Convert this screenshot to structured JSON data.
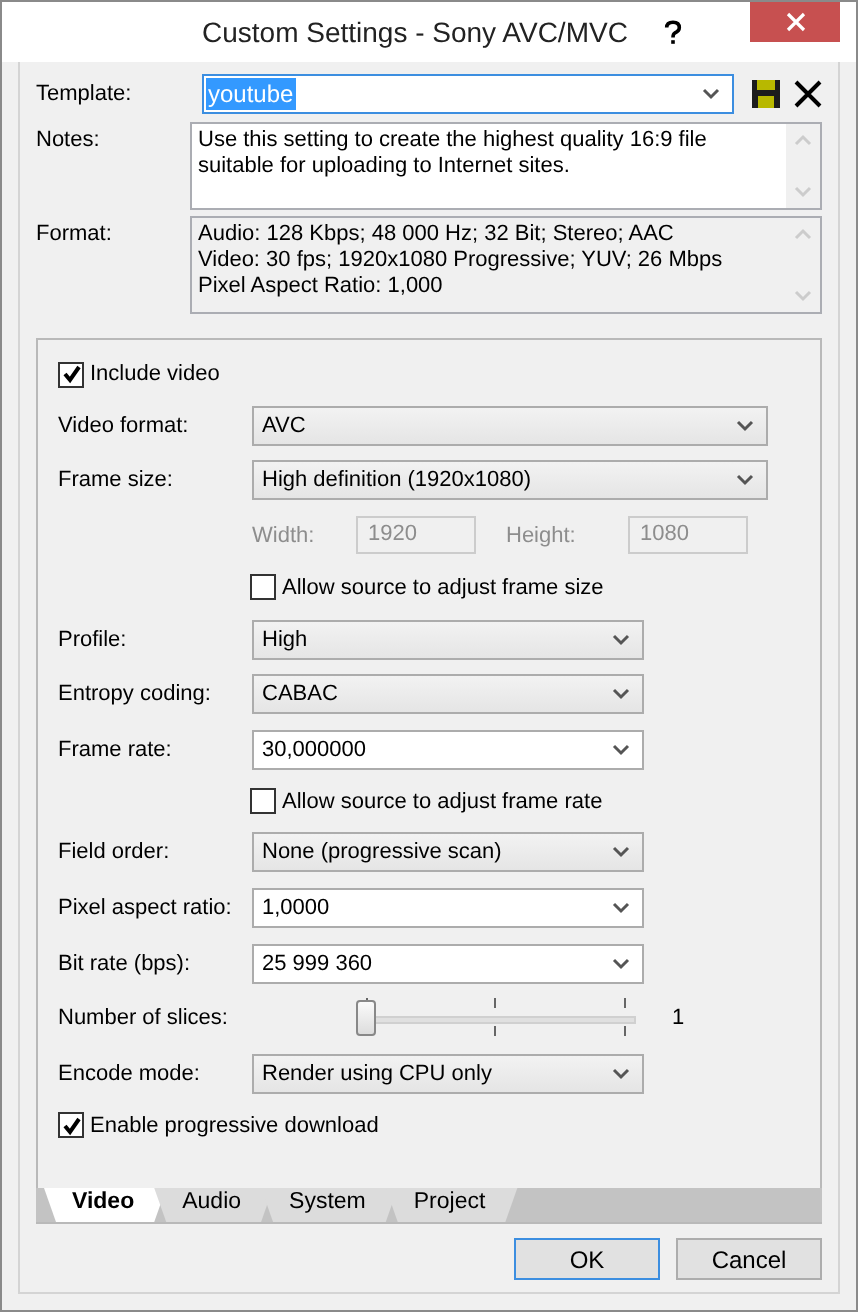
{
  "window": {
    "title": "Custom Settings - Sony AVC/MVC"
  },
  "template": {
    "label": "Template:",
    "value": "youtube",
    "selected": true
  },
  "notes": {
    "label": "Notes:",
    "text": "Use this setting to create the highest quality 16:9 file suitable for uploading to Internet sites."
  },
  "format": {
    "label": "Format:",
    "lines": [
      "Audio: 128 Kbps; 48 000 Hz; 32 Bit; Stereo; AAC",
      "Video: 30 fps; 1920x1080 Progressive; YUV; 26 Mbps",
      "Pixel Aspect Ratio: 1,000"
    ]
  },
  "video_settings": [
    {
      "kind": "checkbox",
      "label": "Include video",
      "checked": true,
      "indent": false
    },
    {
      "kind": "select",
      "label": "Video format:",
      "value": "AVC",
      "editable": false,
      "wide": true
    },
    {
      "kind": "select",
      "label": "Frame size:",
      "value": "High definition (1920x1080)",
      "editable": false,
      "wide": true
    },
    {
      "kind": "size",
      "width_label": "Width:",
      "width_value": "1920",
      "height_label": "Height:",
      "height_value": "1080",
      "disabled": true
    },
    {
      "kind": "checkbox",
      "label": "Allow source to adjust frame size",
      "checked": false,
      "indent": true
    },
    {
      "kind": "select",
      "label": "Profile:",
      "value": "High",
      "editable": false,
      "wide": false
    },
    {
      "kind": "select",
      "label": "Entropy coding:",
      "value": "CABAC",
      "editable": false,
      "wide": false
    },
    {
      "kind": "select",
      "label": "Frame rate:",
      "value": "30,000000",
      "editable": true,
      "wide": false
    },
    {
      "kind": "checkbox",
      "label": "Allow source to adjust frame rate",
      "checked": false,
      "indent": true
    },
    {
      "kind": "select",
      "label": "Field order:",
      "value": "None (progressive scan)",
      "editable": false,
      "wide": false
    },
    {
      "kind": "select",
      "label": "Pixel aspect ratio:",
      "value": "1,0000",
      "editable": true,
      "wide": false
    },
    {
      "kind": "select",
      "label": "Bit rate (bps):",
      "value": "25 999 360",
      "editable": true,
      "wide": false
    },
    {
      "kind": "slider",
      "label": "Number of slices:",
      "level": 0,
      "reading": "1"
    },
    {
      "kind": "select",
      "label": "Encode mode:",
      "value": "Render using CPU only",
      "editable": false,
      "wide": false
    },
    {
      "kind": "checkbox",
      "label": "Enable progressive download",
      "checked": true,
      "indent": false
    }
  ],
  "tabs": [
    {
      "label": "Video",
      "selected": true
    },
    {
      "label": "Audio",
      "selected": false
    },
    {
      "label": "System",
      "selected": false
    },
    {
      "label": "Project",
      "selected": false
    }
  ],
  "buttons": [
    {
      "label": "OK",
      "default": true
    },
    {
      "label": "Cancel",
      "default": false
    }
  ]
}
